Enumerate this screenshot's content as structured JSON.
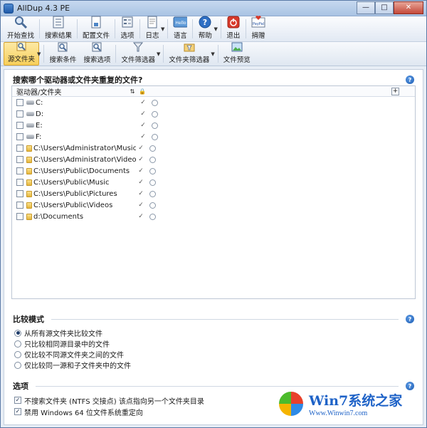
{
  "window": {
    "title": "AllDup 4.3 PE",
    "min": "—",
    "max": "□",
    "close": "✕"
  },
  "toolbar1": [
    {
      "id": "start",
      "label": "开始查找",
      "icon": "magnifier-icon"
    },
    {
      "id": "results",
      "label": "搜索结果",
      "icon": "results-icon"
    },
    {
      "id": "config",
      "label": "配置文件",
      "icon": "config-icon"
    },
    {
      "id": "options",
      "label": "选项",
      "icon": "options-icon"
    },
    {
      "id": "log",
      "label": "日志",
      "icon": "log-icon"
    },
    {
      "id": "lang",
      "label": "语言",
      "icon": "hello-icon",
      "icon_text": "Hello"
    },
    {
      "id": "help",
      "label": "帮助",
      "icon": "help-icon"
    },
    {
      "id": "exit",
      "label": "退出",
      "icon": "power-icon"
    },
    {
      "id": "donate",
      "label": "捐赠",
      "icon": "paypal-icon",
      "icon_text": "PayPal"
    }
  ],
  "toolbar2": [
    {
      "id": "source",
      "label": "源文件夹",
      "active": true
    },
    {
      "id": "criteria",
      "label": "搜索条件"
    },
    {
      "id": "searchopts",
      "label": "搜索选项"
    },
    {
      "id": "filefilter",
      "label": "文件筛选器"
    },
    {
      "id": "folderfilter",
      "label": "文件夹筛选器"
    },
    {
      "id": "preview",
      "label": "文件预览"
    }
  ],
  "section1": {
    "title": "搜索哪个驱动器或文件夹重复的文件?",
    "col_name": "驱动器/文件夹",
    "rows": [
      {
        "name": "C:",
        "type": "drive"
      },
      {
        "name": "D:",
        "type": "drive"
      },
      {
        "name": "E:",
        "type": "drive"
      },
      {
        "name": "F:",
        "type": "drive"
      },
      {
        "name": "C:\\Users\\Administrator\\Music",
        "type": "folder"
      },
      {
        "name": "C:\\Users\\Administrator\\Videos",
        "type": "folder"
      },
      {
        "name": "C:\\Users\\Public\\Documents",
        "type": "folder"
      },
      {
        "name": "C:\\Users\\Public\\Music",
        "type": "folder"
      },
      {
        "name": "C:\\Users\\Public\\Pictures",
        "type": "folder"
      },
      {
        "name": "C:\\Users\\Public\\Videos",
        "type": "folder"
      },
      {
        "name": "d:\\Documents",
        "type": "folder"
      }
    ]
  },
  "section2": {
    "title": "比较模式",
    "options": [
      {
        "label": "从所有源文件夹比较文件",
        "selected": true
      },
      {
        "label": "只比较相同源目录中的文件",
        "selected": false
      },
      {
        "label": "仅比较不同源文件夹之间的文件",
        "selected": false
      },
      {
        "label": "仅比较同一源和子文件夹中的文件",
        "selected": false
      }
    ]
  },
  "section3": {
    "title": "选项",
    "options": [
      {
        "label": "不搜索文件夹 (NTFS 交接点) 该点指向另一个文件夹目录",
        "checked": true
      },
      {
        "label": "禁用 Windows 64 位文件系统重定向",
        "checked": true
      }
    ]
  },
  "watermark": {
    "title": "Win7系统之家",
    "url": "Www.Winwin7.com"
  }
}
